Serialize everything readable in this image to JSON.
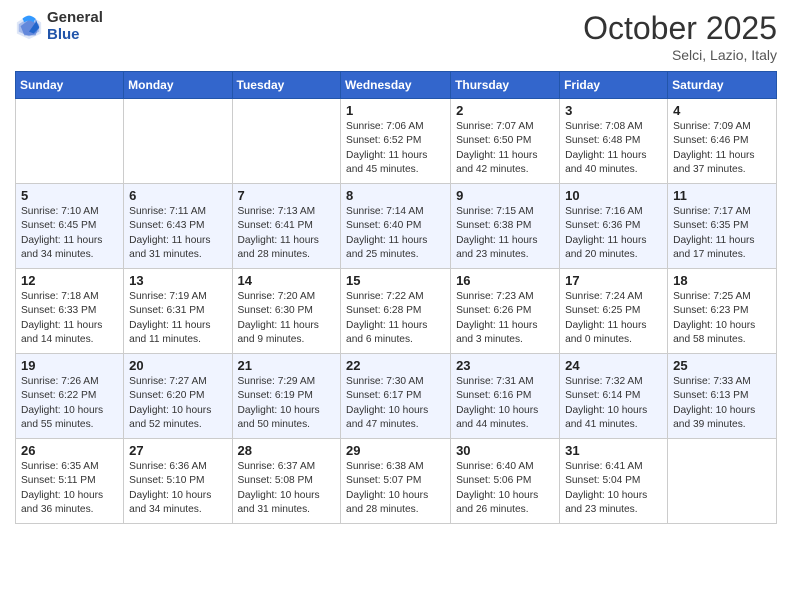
{
  "logo": {
    "general": "General",
    "blue": "Blue"
  },
  "title": "October 2025",
  "location": "Selci, Lazio, Italy",
  "days_of_week": [
    "Sunday",
    "Monday",
    "Tuesday",
    "Wednesday",
    "Thursday",
    "Friday",
    "Saturday"
  ],
  "weeks": [
    [
      {
        "day": "",
        "info": ""
      },
      {
        "day": "",
        "info": ""
      },
      {
        "day": "",
        "info": ""
      },
      {
        "day": "1",
        "info": "Sunrise: 7:06 AM\nSunset: 6:52 PM\nDaylight: 11 hours and 45 minutes."
      },
      {
        "day": "2",
        "info": "Sunrise: 7:07 AM\nSunset: 6:50 PM\nDaylight: 11 hours and 42 minutes."
      },
      {
        "day": "3",
        "info": "Sunrise: 7:08 AM\nSunset: 6:48 PM\nDaylight: 11 hours and 40 minutes."
      },
      {
        "day": "4",
        "info": "Sunrise: 7:09 AM\nSunset: 6:46 PM\nDaylight: 11 hours and 37 minutes."
      }
    ],
    [
      {
        "day": "5",
        "info": "Sunrise: 7:10 AM\nSunset: 6:45 PM\nDaylight: 11 hours and 34 minutes."
      },
      {
        "day": "6",
        "info": "Sunrise: 7:11 AM\nSunset: 6:43 PM\nDaylight: 11 hours and 31 minutes."
      },
      {
        "day": "7",
        "info": "Sunrise: 7:13 AM\nSunset: 6:41 PM\nDaylight: 11 hours and 28 minutes."
      },
      {
        "day": "8",
        "info": "Sunrise: 7:14 AM\nSunset: 6:40 PM\nDaylight: 11 hours and 25 minutes."
      },
      {
        "day": "9",
        "info": "Sunrise: 7:15 AM\nSunset: 6:38 PM\nDaylight: 11 hours and 23 minutes."
      },
      {
        "day": "10",
        "info": "Sunrise: 7:16 AM\nSunset: 6:36 PM\nDaylight: 11 hours and 20 minutes."
      },
      {
        "day": "11",
        "info": "Sunrise: 7:17 AM\nSunset: 6:35 PM\nDaylight: 11 hours and 17 minutes."
      }
    ],
    [
      {
        "day": "12",
        "info": "Sunrise: 7:18 AM\nSunset: 6:33 PM\nDaylight: 11 hours and 14 minutes."
      },
      {
        "day": "13",
        "info": "Sunrise: 7:19 AM\nSunset: 6:31 PM\nDaylight: 11 hours and 11 minutes."
      },
      {
        "day": "14",
        "info": "Sunrise: 7:20 AM\nSunset: 6:30 PM\nDaylight: 11 hours and 9 minutes."
      },
      {
        "day": "15",
        "info": "Sunrise: 7:22 AM\nSunset: 6:28 PM\nDaylight: 11 hours and 6 minutes."
      },
      {
        "day": "16",
        "info": "Sunrise: 7:23 AM\nSunset: 6:26 PM\nDaylight: 11 hours and 3 minutes."
      },
      {
        "day": "17",
        "info": "Sunrise: 7:24 AM\nSunset: 6:25 PM\nDaylight: 11 hours and 0 minutes."
      },
      {
        "day": "18",
        "info": "Sunrise: 7:25 AM\nSunset: 6:23 PM\nDaylight: 10 hours and 58 minutes."
      }
    ],
    [
      {
        "day": "19",
        "info": "Sunrise: 7:26 AM\nSunset: 6:22 PM\nDaylight: 10 hours and 55 minutes."
      },
      {
        "day": "20",
        "info": "Sunrise: 7:27 AM\nSunset: 6:20 PM\nDaylight: 10 hours and 52 minutes."
      },
      {
        "day": "21",
        "info": "Sunrise: 7:29 AM\nSunset: 6:19 PM\nDaylight: 10 hours and 50 minutes."
      },
      {
        "day": "22",
        "info": "Sunrise: 7:30 AM\nSunset: 6:17 PM\nDaylight: 10 hours and 47 minutes."
      },
      {
        "day": "23",
        "info": "Sunrise: 7:31 AM\nSunset: 6:16 PM\nDaylight: 10 hours and 44 minutes."
      },
      {
        "day": "24",
        "info": "Sunrise: 7:32 AM\nSunset: 6:14 PM\nDaylight: 10 hours and 41 minutes."
      },
      {
        "day": "25",
        "info": "Sunrise: 7:33 AM\nSunset: 6:13 PM\nDaylight: 10 hours and 39 minutes."
      }
    ],
    [
      {
        "day": "26",
        "info": "Sunrise: 6:35 AM\nSunset: 5:11 PM\nDaylight: 10 hours and 36 minutes."
      },
      {
        "day": "27",
        "info": "Sunrise: 6:36 AM\nSunset: 5:10 PM\nDaylight: 10 hours and 34 minutes."
      },
      {
        "day": "28",
        "info": "Sunrise: 6:37 AM\nSunset: 5:08 PM\nDaylight: 10 hours and 31 minutes."
      },
      {
        "day": "29",
        "info": "Sunrise: 6:38 AM\nSunset: 5:07 PM\nDaylight: 10 hours and 28 minutes."
      },
      {
        "day": "30",
        "info": "Sunrise: 6:40 AM\nSunset: 5:06 PM\nDaylight: 10 hours and 26 minutes."
      },
      {
        "day": "31",
        "info": "Sunrise: 6:41 AM\nSunset: 5:04 PM\nDaylight: 10 hours and 23 minutes."
      },
      {
        "day": "",
        "info": ""
      }
    ]
  ]
}
